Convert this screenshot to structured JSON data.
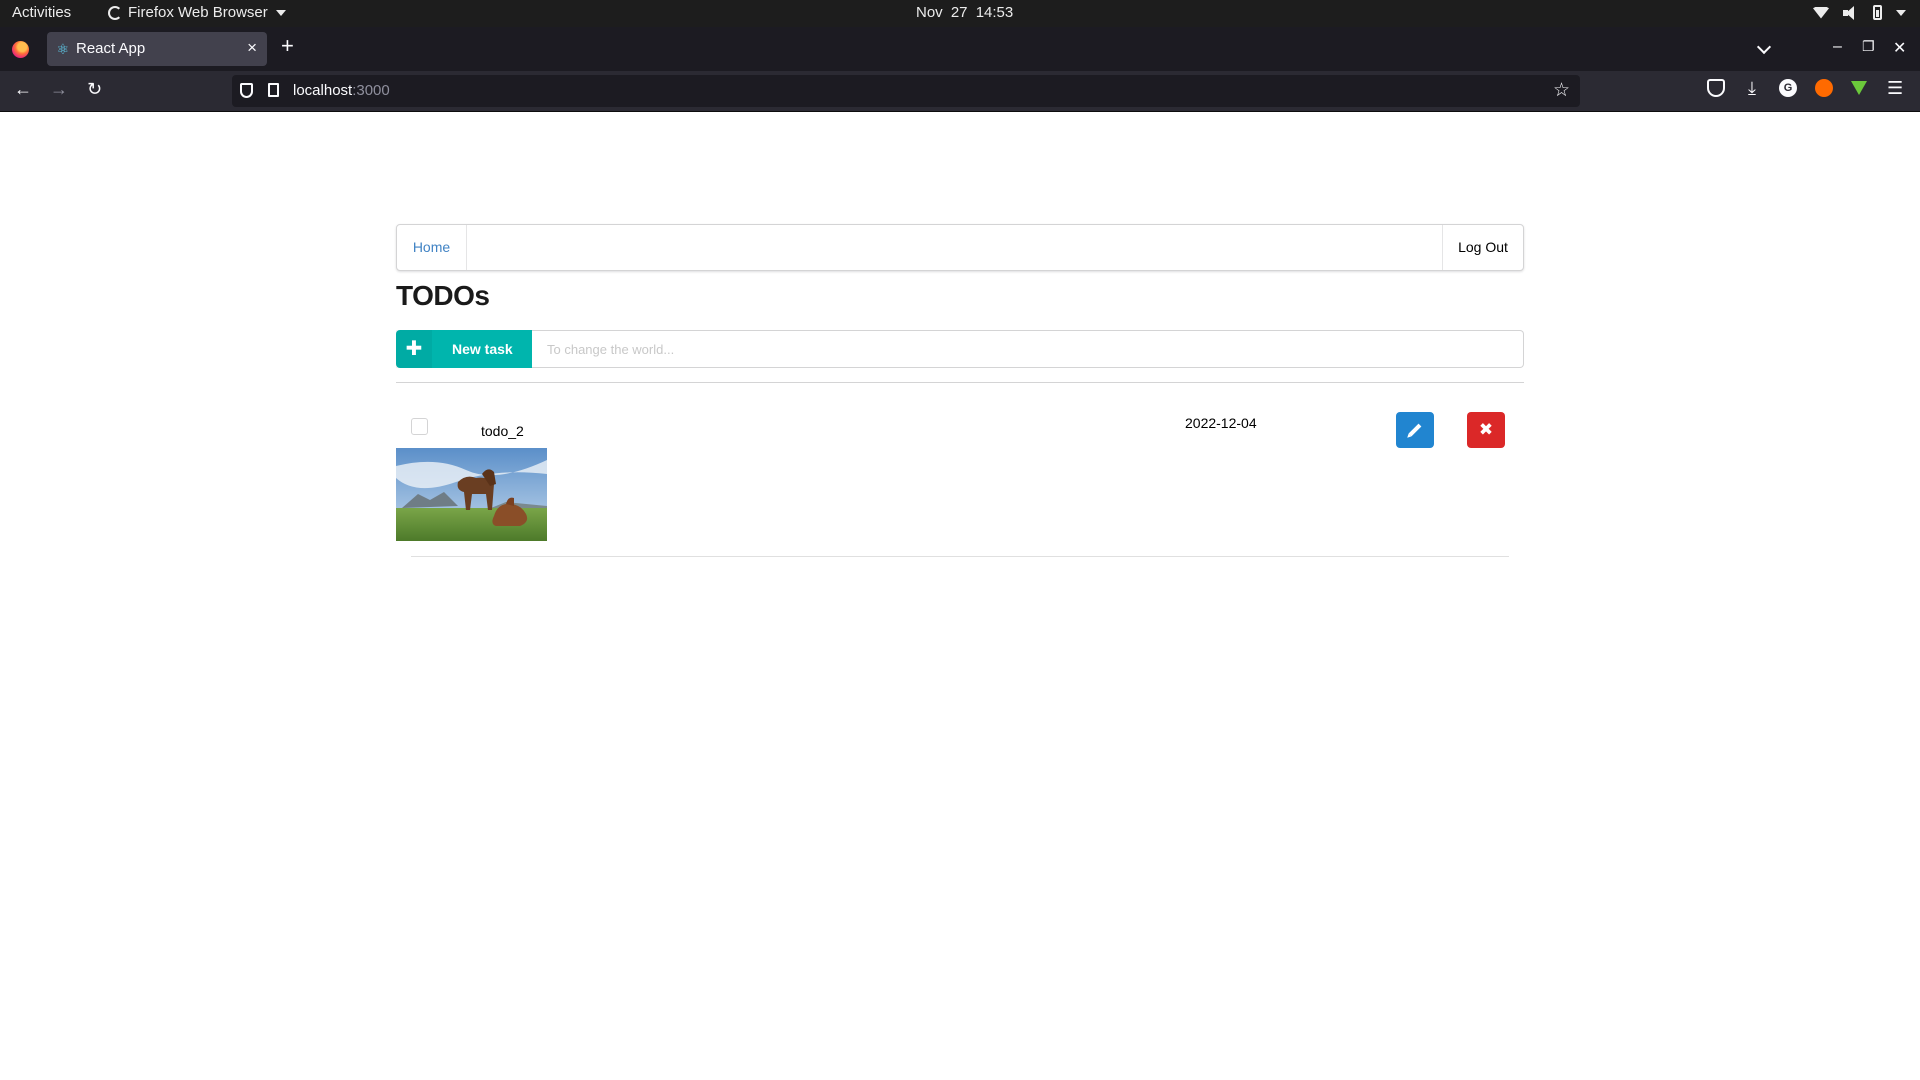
{
  "system_bar": {
    "activities": "Activities",
    "app_name": "Firefox Web Browser",
    "clock": "Nov 27  14:53"
  },
  "browser": {
    "tab_title": "React App",
    "tab_close": "×",
    "new_tab": "+",
    "url_host": "localhost",
    "url_rest": ":3000",
    "win_minimize": "–",
    "win_restore": "❐",
    "win_close": "✕"
  },
  "page": {
    "menu": {
      "home": "Home",
      "logout": "Log Out"
    },
    "heading": "TODOs",
    "new_task_label": "New task",
    "input_placeholder": "To change the world...",
    "todos": [
      {
        "title": "todo_2",
        "date": "2022-12-04",
        "image": "horses-in-meadow"
      }
    ]
  },
  "colors": {
    "teal": "#00b5ad",
    "blue": "#2185d0",
    "red": "#db2828",
    "link": "#4183c4"
  }
}
